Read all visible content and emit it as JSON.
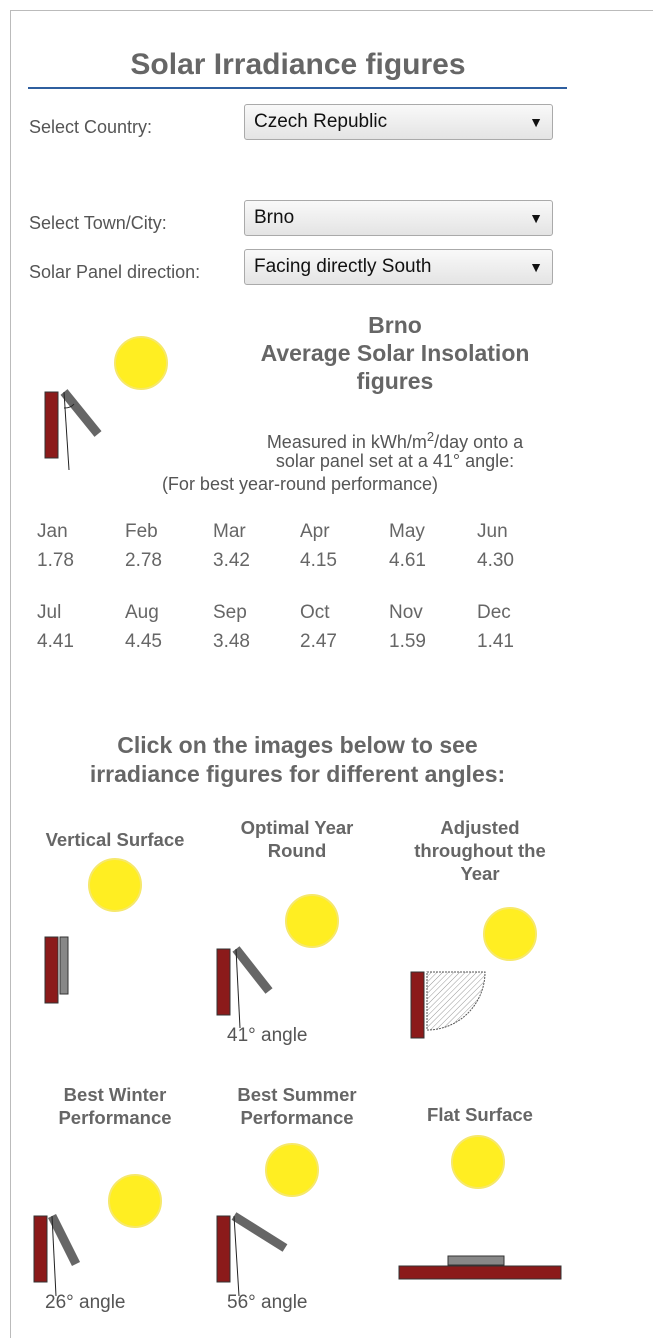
{
  "page": {
    "title": "Solar Irradiance figures"
  },
  "form": {
    "country_label": "Select Country:",
    "country_value": "Czech Republic",
    "town_label": "Select Town/City:",
    "town_value": "Brno",
    "direction_label": "Solar Panel direction:",
    "direction_value": "Facing directly South"
  },
  "summary": {
    "town": "Brno",
    "heading_1": "Average Solar Insolation",
    "heading_2": "figures",
    "measured_a": "Measured in kWh/m",
    "measured_sup": "2",
    "measured_b": "/day onto a",
    "measured_line2": "solar panel set at a 41° angle:",
    "measured_line3": "(For best year-round performance)"
  },
  "months": [
    {
      "name": "Jan",
      "value": "1.78"
    },
    {
      "name": "Feb",
      "value": "2.78"
    },
    {
      "name": "Mar",
      "value": "3.42"
    },
    {
      "name": "Apr",
      "value": "4.15"
    },
    {
      "name": "May",
      "value": "4.61"
    },
    {
      "name": "Jun",
      "value": "4.30"
    },
    {
      "name": "Jul",
      "value": "4.41"
    },
    {
      "name": "Aug",
      "value": "4.45"
    },
    {
      "name": "Sep",
      "value": "3.48"
    },
    {
      "name": "Oct",
      "value": "2.47"
    },
    {
      "name": "Nov",
      "value": "1.59"
    },
    {
      "name": "Dec",
      "value": "1.41"
    }
  ],
  "angles_section": {
    "heading_1": "Click on the images below to see",
    "heading_2": "irradiance figures for different angles:"
  },
  "cards": [
    {
      "title_1": "Vertical Surface",
      "title_2": "",
      "title_3": "",
      "angle": ""
    },
    {
      "title_1": "Optimal Year",
      "title_2": "Round",
      "title_3": "",
      "angle": "41° angle"
    },
    {
      "title_1": "Adjusted",
      "title_2": "throughout the",
      "title_3": "Year",
      "angle": ""
    },
    {
      "title_1": "Best Winter",
      "title_2": "Performance",
      "title_3": "",
      "angle": "26° angle"
    },
    {
      "title_1": "Best Summer",
      "title_2": "Performance",
      "title_3": "",
      "angle": "56° angle"
    },
    {
      "title_1": "Flat Surface",
      "title_2": "",
      "title_3": "",
      "angle": ""
    }
  ],
  "icons": {
    "dropdown": "▼",
    "sun": "sun-icon",
    "wall": "wall-icon",
    "panel": "solar-panel-icon"
  },
  "colors": {
    "sun": "#ffee22",
    "wall": "#8b1a1a",
    "panel": "#888888",
    "rule": "#2f5f9f"
  }
}
